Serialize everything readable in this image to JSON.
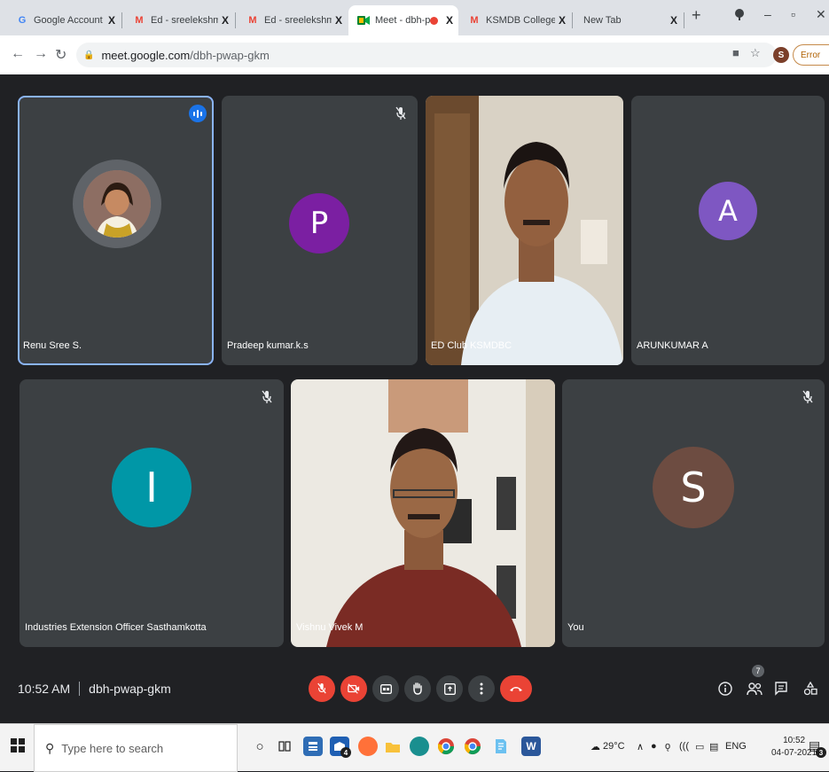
{
  "browser": {
    "tabs": [
      {
        "title": "Google Account",
        "favicon": "G",
        "color": "#4285f4"
      },
      {
        "title": "Ed - sreelekshmyhg@",
        "favicon": "M",
        "color": "#ea4335"
      },
      {
        "title": "Ed - sreelekshmyhg@",
        "favicon": "M",
        "color": "#ea4335"
      },
      {
        "title": "Meet - dbh-pwap",
        "favicon": "meet-icon",
        "color": "#00832d"
      },
      {
        "title": "KSMDB College, Sasth",
        "favicon": "M",
        "color": "#ea4335"
      },
      {
        "title": "New Tab",
        "favicon": "",
        "color": "#5f6368"
      }
    ],
    "tab_close": "X",
    "new_tab": "+",
    "url_host": "meet.google.com",
    "url_path": "/dbh-pwap-gkm",
    "profile_initial": "S",
    "error_label": "Error"
  },
  "meet": {
    "participants": [
      {
        "name": "Renu Sree S.",
        "kind": "photo",
        "speaking": true
      },
      {
        "name": "Pradeep kumar.k.s",
        "initial": "P",
        "color": "#7b1fa2",
        "muted": true
      },
      {
        "name": "ED Club KSMDBC",
        "kind": "video"
      },
      {
        "name": "ARUNKUMAR A",
        "initial": "A",
        "color": "#7e57c2"
      },
      {
        "name": "Industries Extension Officer Sasthamkotta",
        "initial": "I",
        "color": "#0097a7",
        "muted": true
      },
      {
        "name": "Vishnu Vivek M",
        "kind": "video"
      },
      {
        "name": "You",
        "initial": "S",
        "color": "#6d4c41",
        "muted": true
      }
    ],
    "time": "10:52 AM",
    "meeting_code": "dbh-pwap-gkm",
    "participant_count": "7",
    "accent": "#ea4335"
  },
  "taskbar": {
    "search_placeholder": "Type here to search",
    "mail_badge": "4",
    "weather": "29°C",
    "language": "ENG",
    "clock_time": "10:52",
    "clock_date": "04-07-2021",
    "notification_count": "3"
  }
}
